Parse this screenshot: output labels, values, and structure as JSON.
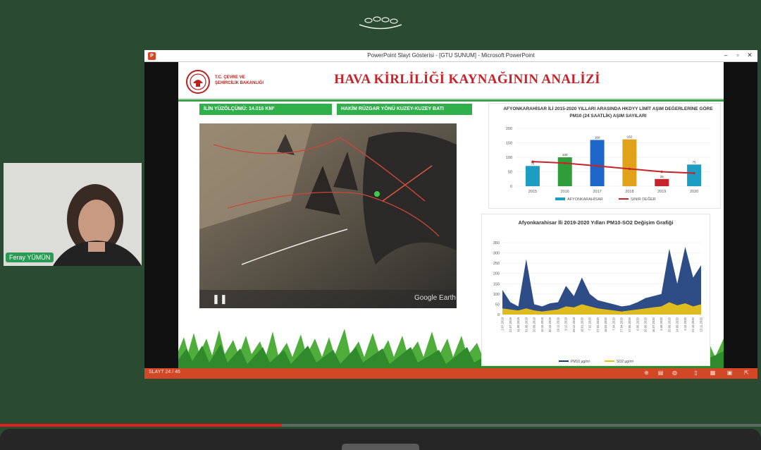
{
  "webcam": {
    "name": "Feray YÜMÜN"
  },
  "window": {
    "title": "PowerPoint Slayt Gösterisi - [GTU SUNUM] - Microsoft PowerPoint"
  },
  "slide": {
    "org_line1": "T.C. ÇEVRE VE",
    "org_line2": "ŞEHİRCİLİK BAKANLIĞI",
    "title": "HAVA KİRLİLİĞİ KAYNAĞININ ANALİZİ",
    "badge_area": "İLİN YÜZÖLÇÜMÜ: 14.016 KM²",
    "badge_wind": "HAKİM RÜZGAR YÖNÜ KUZEY-KUZEY BATI",
    "map_watermark": "Google Earth"
  },
  "status": {
    "slide_counter": "SLAYT 24 / 46"
  },
  "colors": {
    "bg": "#2a4a32",
    "accent_red": "#c6242a",
    "accent_green": "#2fb04a",
    "ppt_orange": "#d24726"
  },
  "chart_data": [
    {
      "type": "bar",
      "title": "AFYONKARAHİSAR İLİ 2015-2020 YILLARI ARASINDA HKDYY LİMİT AŞIM DEĞERLERİNE GÖRE PM10 (24 SAATLİK) AŞIM SAYILARI",
      "categories": [
        "2015",
        "2016",
        "2017",
        "2018",
        "2019",
        "2020"
      ],
      "series": [
        {
          "name": "AFYONKARAHİSAR",
          "values": [
            70,
            100,
            160,
            162,
            25,
            75
          ],
          "colors": [
            "#1e9dc4",
            "#2f9e3a",
            "#1f66c9",
            "#e0a21a",
            "#c6242a",
            "#1e9dc4"
          ]
        },
        {
          "name": "SINIR DEĞER",
          "type": "line",
          "values": [
            85,
            80,
            70,
            60,
            50,
            45
          ],
          "color": "#c6242a"
        }
      ],
      "ylim": [
        0,
        200
      ],
      "yticks": [
        "0",
        "50",
        "100",
        "150",
        "200"
      ],
      "legend": "bottom"
    },
    {
      "type": "area",
      "title": "Afyonkarahisar İli 2019-2020 Yılları PM10-SO2 Değişim Grafiği",
      "ylim": [
        0,
        350
      ],
      "yticks": [
        "0",
        "50",
        "100",
        "150",
        "200",
        "250",
        "300",
        "350"
      ],
      "x": [
        "2.07.2019",
        "22.07.2019",
        "11.08.2019",
        "31.08.2019",
        "20.09.2019",
        "10.10.2019",
        "30.10.2019",
        "19.11.2019",
        "9.12.2019",
        "29.12.2019",
        "18.01.2020",
        "7.02.2020",
        "27.02.2020",
        "18.03.2020",
        "7.04.2020",
        "27.04.2020",
        "17.05.2020",
        "6.06.2020",
        "26.06.2020",
        "16.07.2020",
        "5.08.2020",
        "25.08.2020",
        "14.09.2020",
        "4.10.2020",
        "24.10.2020",
        "13.11.2020"
      ],
      "series": [
        {
          "name": "PM10 µg/m³",
          "color": "#173a7a",
          "values": [
            120,
            60,
            40,
            270,
            50,
            40,
            55,
            60,
            140,
            90,
            180,
            100,
            70,
            60,
            50,
            40,
            45,
            60,
            80,
            90,
            100,
            320,
            150,
            330,
            180,
            240
          ]
        },
        {
          "name": "SO2 µg/m³",
          "color": "#e8c21a",
          "values": [
            30,
            25,
            20,
            30,
            20,
            15,
            20,
            25,
            40,
            35,
            50,
            40,
            30,
            25,
            20,
            15,
            20,
            25,
            30,
            35,
            40,
            60,
            45,
            55,
            40,
            50
          ]
        }
      ],
      "legend": "bottom"
    }
  ]
}
